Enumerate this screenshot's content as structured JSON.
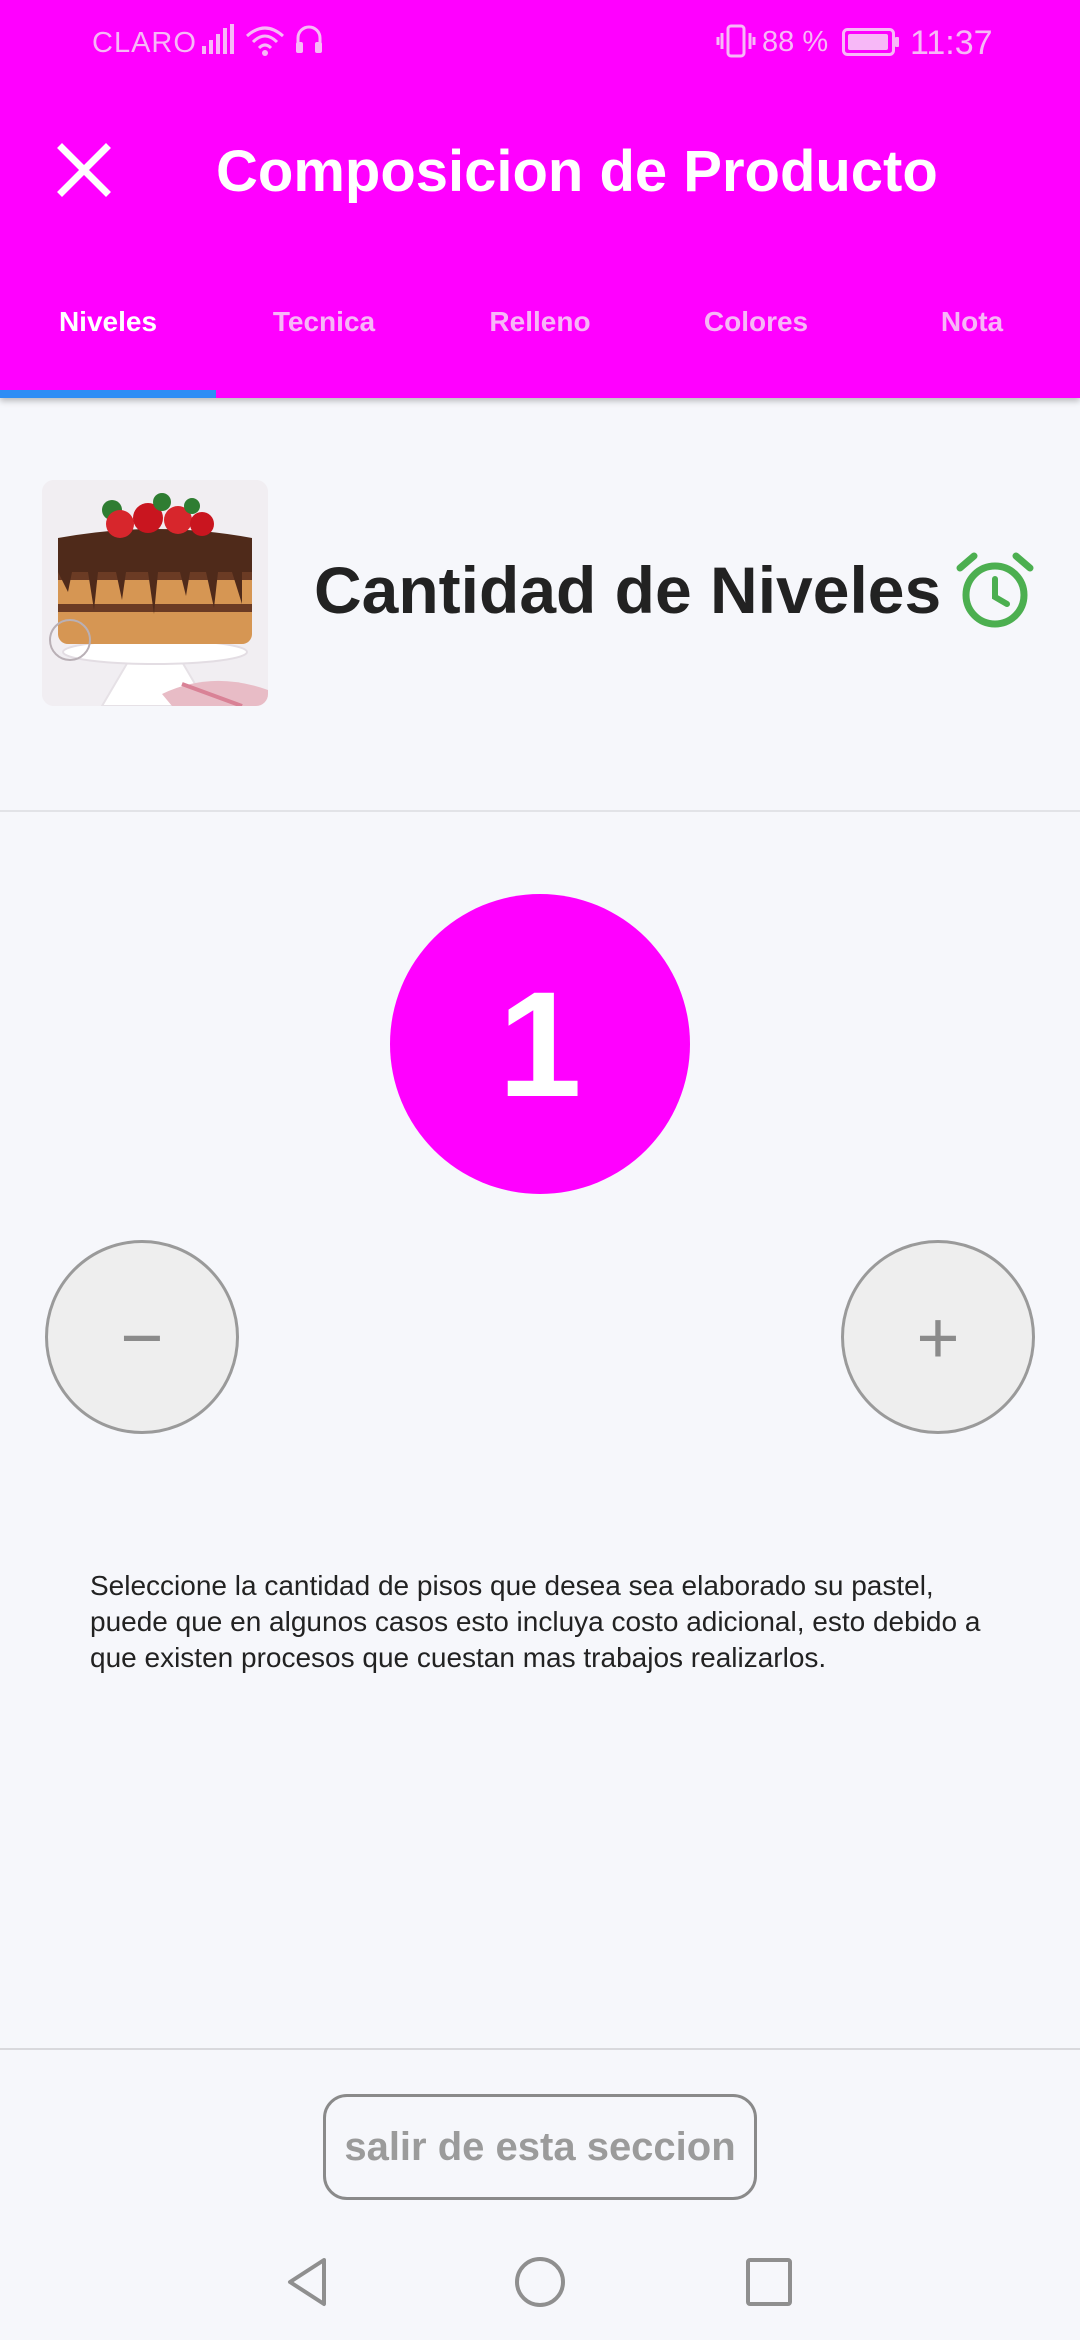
{
  "status_bar": {
    "carrier": "CLARO",
    "battery_percent": "88 %",
    "time": "11:37",
    "icons": [
      "signal-icon",
      "wifi-icon",
      "headset-icon",
      "vibrate-icon",
      "battery-icon"
    ]
  },
  "header": {
    "title": "Composicion de Producto",
    "close_icon": "close-icon",
    "background_color": "#ff00ff"
  },
  "tabs": [
    {
      "label": "Niveles",
      "active": true
    },
    {
      "label": "Tecnica",
      "active": false
    },
    {
      "label": "Relleno",
      "active": false
    },
    {
      "label": "Colores",
      "active": false
    },
    {
      "label": "Nota",
      "active": false
    }
  ],
  "section": {
    "title": "Cantidad de Niveles",
    "image": "cake-image",
    "timer_icon": "alarm-clock-icon",
    "timer_icon_color": "#4caf50"
  },
  "counter": {
    "value": "1",
    "decrement_label": "−",
    "increment_label": "+"
  },
  "description": "Seleccione la cantidad de pisos que desea sea elaborado su pastel, puede que en algunos casos esto incluya costo adicional, esto debido a que existen procesos que cuestan mas trabajos realizarlos.",
  "footer": {
    "exit_label": "salir de esta seccion"
  },
  "nav_bar": {
    "icons": [
      "back-icon",
      "home-icon",
      "recents-icon"
    ]
  },
  "colors": {
    "accent": "#ff00ff",
    "tab_indicator": "#2f8df5"
  }
}
